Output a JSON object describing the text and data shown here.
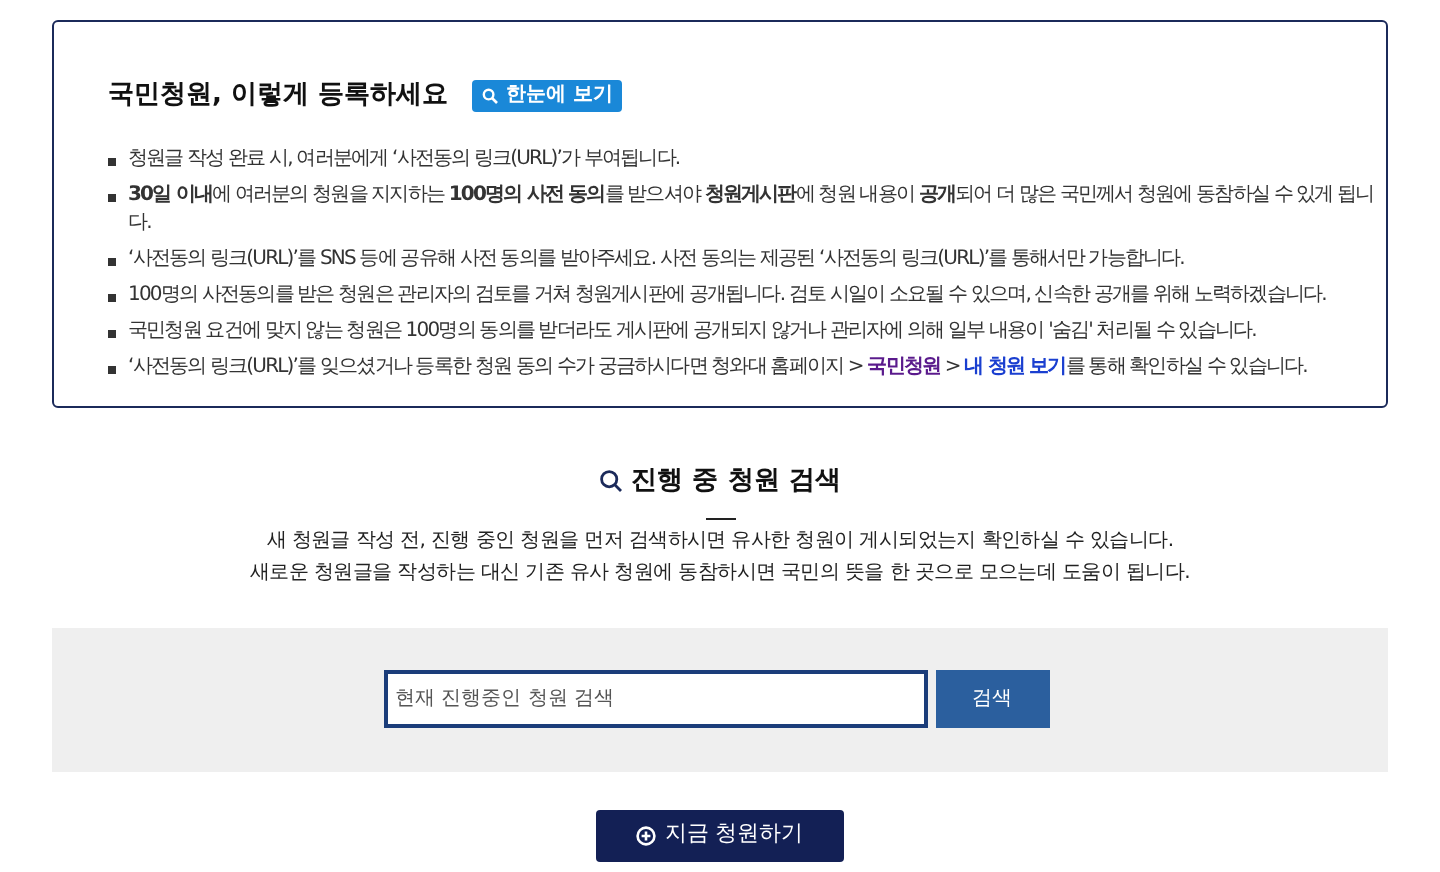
{
  "guide": {
    "title": "국민청원, 이렇게 등록하세요",
    "overview_button": "한눈에 보기",
    "bullets": [
      {
        "parts": [
          {
            "kind": "text",
            "text": "청원글 작성 완료 시, 여러분에게 ‘사전동의 링크(URL)’가 부여됩니다."
          }
        ]
      },
      {
        "parts": [
          {
            "kind": "text",
            "text": "**30일 이내**에 여러분의 청원을 지지하는 **100명의 사전 동의**를 받으셔야 **청원게시판**에 청원 내용이 **공개**되어 더 많은 국민께서 청원에 동참하실 수 있게 됩니다."
          }
        ]
      },
      {
        "parts": [
          {
            "kind": "text",
            "text": "‘사전동의 링크(URL)’를 SNS 등에 공유해 사전 동의를 받아주세요. 사전 동의는 제공된 ‘사전동의 링크(URL)’를 통해서만 가능합니다."
          }
        ]
      },
      {
        "parts": [
          {
            "kind": "text",
            "text": "100명의 사전동의를 받은 청원은 관리자의 검토를 거쳐 청원게시판에 공개됩니다. 검토 시일이 소요될 수 있으며, 신속한 공개를 위해 노력하겠습니다."
          }
        ]
      },
      {
        "parts": [
          {
            "kind": "text",
            "text": "국민청원 요건에 맞지 않는 청원은 100명의 동의를 받더라도 게시판에 공개되지 않거나 관리자에 의해 일부 내용이 '숨김' 처리될 수 있습니다."
          }
        ]
      },
      {
        "parts": [
          {
            "kind": "text",
            "text": "‘사전동의 링크(URL)’를 잊으셨거나 등록한 청원 동의 수가 궁금하시다면 청와대 홈페이지 > "
          },
          {
            "kind": "link",
            "text": "국민청원",
            "visited": true
          },
          {
            "kind": "text",
            "text": " > "
          },
          {
            "kind": "link",
            "text": "내 청원 보기",
            "visited": false
          },
          {
            "kind": "text",
            "text": "를 통해 확인하실 수 있습니다."
          }
        ]
      }
    ]
  },
  "search_section": {
    "title": "진행 중 청원 검색",
    "descriptions": [
      "새 청원글 작성 전, 진행 중인 청원을 먼저 검색하시면 유사한 청원이 게시되었는지 확인하실 수 있습니다.",
      "새로운 청원글을 작성하는 대신 기존 유사 청원에 동참하시면 국민의 뜻을 한 곳으로 모으는데 도움이 됩니다."
    ],
    "search": {
      "placeholder": "현재 진행중인 청원 검색",
      "button": "검색"
    }
  },
  "petition_button": "지금 청원하기"
}
